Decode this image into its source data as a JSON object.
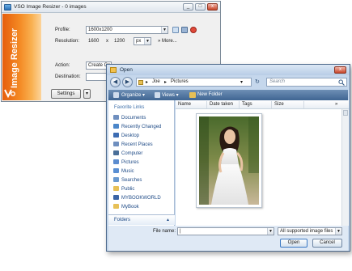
{
  "resizer": {
    "title": "VSO Image Resizer - 0 images",
    "brand_text": "Image Resizer",
    "profile_label": "Profile:",
    "profile_value": "1600x1200",
    "resolution_label": "Resolution:",
    "width_value": "1600",
    "x_sep": "x",
    "height_value": "1200",
    "unit_value": "px",
    "more_label": "» More...",
    "action_label": "Action:",
    "action_value": "Create Co",
    "destination_label": "Destination:",
    "settings_label": "Settings",
    "settings_arrow": "▾",
    "minimize_label": "_",
    "maximize_label": "□",
    "close_label": "x"
  },
  "dialog": {
    "title": "Open",
    "close_label": "x",
    "back_glyph": "◀",
    "forward_glyph": "▶",
    "address": {
      "seg1": "Joe",
      "seg2": "Pictures",
      "sep": "▸"
    },
    "refresh_glyph": "↻",
    "search_placeholder": "Search",
    "toolbar": {
      "organize": "Organize ▾",
      "views": "Views ▾",
      "new_folder": "New Folder"
    },
    "favorite_links_label": "Favorite Links",
    "favorites": [
      {
        "label": "Documents",
        "color": "#6f8fbf"
      },
      {
        "label": "Recently Changed",
        "color": "#4b86c9"
      },
      {
        "label": "Desktop",
        "color": "#3d6cb3"
      },
      {
        "label": "Recent Places",
        "color": "#6f8fbf"
      },
      {
        "label": "Computer",
        "color": "#4a6f99"
      },
      {
        "label": "Pictures",
        "color": "#5c8ccf"
      },
      {
        "label": "Music",
        "color": "#5a8fd3"
      },
      {
        "label": "Searches",
        "color": "#6a9ad0"
      },
      {
        "label": "Public",
        "color": "#e7c056"
      },
      {
        "label": "MYBOOKWORLD",
        "color": "#3c65a6"
      },
      {
        "label": "MyBook",
        "color": "#e7c056"
      }
    ],
    "folders_label": "Folders",
    "folders_arrow": "▲",
    "columns": [
      "Name",
      "Date taken",
      "Tags",
      "Size"
    ],
    "columns_more": "»",
    "filename_label": "File name:",
    "filename_value": "|",
    "filter_value": "All supported image files",
    "open_label": "Open",
    "cancel_label": "Cancel"
  }
}
